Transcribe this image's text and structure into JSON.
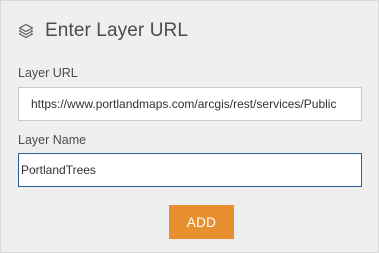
{
  "dialog": {
    "title": "Enter Layer URL",
    "title_icon": "layers-icon"
  },
  "layer_url": {
    "label": "Layer URL",
    "value": "https://www.portlandmaps.com/arcgis/rest/services/Public"
  },
  "layer_name": {
    "label": "Layer Name",
    "value": "PortlandTrees"
  },
  "add_button": {
    "label": "ADD",
    "color": "#e8902e"
  },
  "colors": {
    "panel_background": "#efefef",
    "focus_border": "#2a5e9c"
  }
}
